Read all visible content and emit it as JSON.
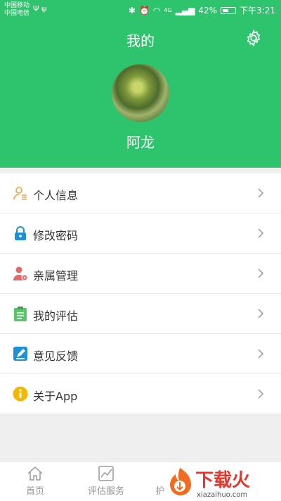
{
  "status": {
    "carrier1": "中国移动",
    "carrier2": "中国电信",
    "usb": "Ψ ψ",
    "network": "4G",
    "battery_percent": "42%",
    "time": "下午3:21"
  },
  "header": {
    "title": "我的",
    "username": "阿龙"
  },
  "menu": {
    "items": [
      {
        "label": "个人信息",
        "icon": "user-info-icon"
      },
      {
        "label": "修改密码",
        "icon": "lock-icon"
      },
      {
        "label": "亲属管理",
        "icon": "family-icon"
      },
      {
        "label": "我的评估",
        "icon": "clipboard-icon"
      },
      {
        "label": "意见反馈",
        "icon": "feedback-icon"
      },
      {
        "label": "关于App",
        "icon": "info-icon"
      }
    ]
  },
  "tabs": [
    {
      "label": "首页",
      "icon": "home-icon"
    },
    {
      "label": "评估服务",
      "icon": "chart-icon"
    },
    {
      "label": "护",
      "icon": "care-icon"
    }
  ],
  "watermark": {
    "title": "下载火",
    "sub": "xiazaihuo.com"
  },
  "colors": {
    "primary": "#2dc46d",
    "icon_orange": "#f0a04b",
    "icon_blue": "#1e90d6",
    "icon_red": "#e06a6a",
    "icon_green": "#5cc46a",
    "icon_yellow": "#f5b800"
  }
}
